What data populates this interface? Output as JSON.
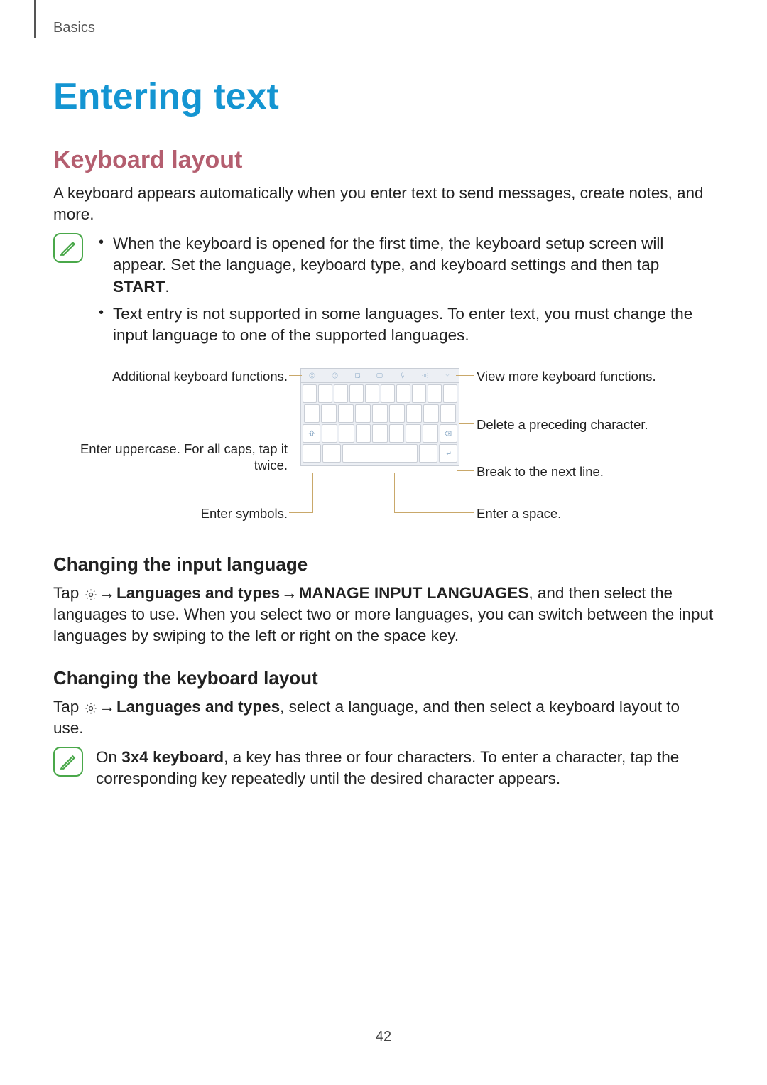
{
  "breadcrumb": "Basics",
  "title": "Entering text",
  "section1_title": "Keyboard layout",
  "section1_body": "A keyboard appears automatically when you enter text to send messages, create notes, and more.",
  "note1_items": [
    {
      "pre": "When the keyboard is opened for the first time, the keyboard setup screen will appear. Set the language, keyboard type, and keyboard settings and then tap ",
      "bold": "START",
      "post": "."
    },
    {
      "pre": "Text entry is not supported in some languages. To enter text, you must change the input language to one of the supported languages.",
      "bold": "",
      "post": ""
    }
  ],
  "diagram": {
    "additional_functions": "Additional keyboard functions.",
    "uppercase": "Enter uppercase. For all caps, tap it twice.",
    "symbols": "Enter symbols.",
    "view_more": "View more keyboard functions.",
    "delete": "Delete a preceding character.",
    "break_line": "Break to the next line.",
    "space": "Enter a space."
  },
  "section2_title": "Changing the input language",
  "section2_text": {
    "pre": "Tap ",
    "arrow": " → ",
    "bold1": "Languages and types",
    "mid": " → ",
    "bold2": "MANAGE INPUT LANGUAGES",
    "post": ", and then select the languages to use. When you select two or more languages, you can switch between the input languages by swiping to the left or right on the space key."
  },
  "section3_title": "Changing the keyboard layout",
  "section3_text": {
    "pre": "Tap ",
    "arrow": " → ",
    "bold1": "Languages and types",
    "post": ", select a language, and then select a keyboard layout to use."
  },
  "note2": {
    "pre": "On ",
    "bold": "3x4 keyboard",
    "post": ", a key has three or four characters. To enter a character, tap the corresponding key repeatedly until the desired character appears."
  },
  "page_number": "42"
}
